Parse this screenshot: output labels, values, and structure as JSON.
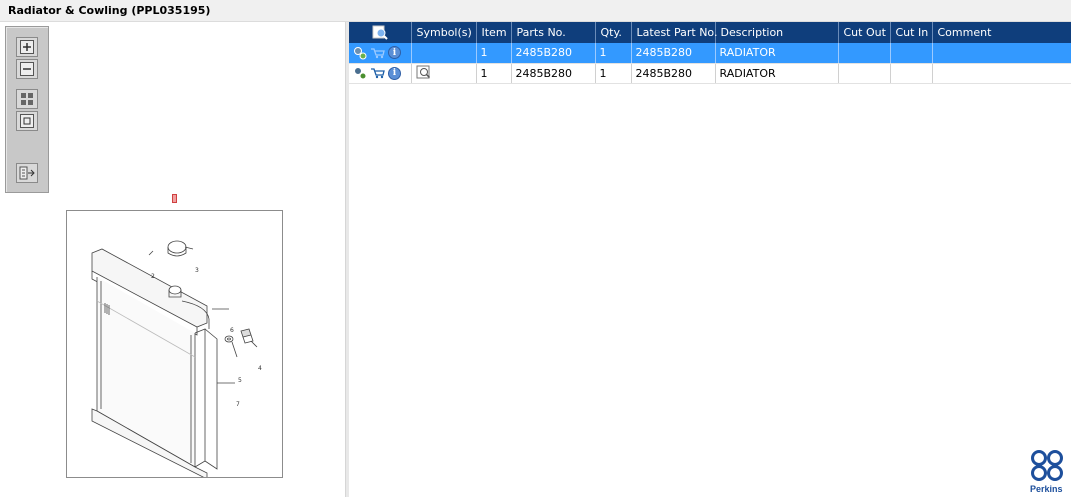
{
  "window": {
    "title": "Radiator & Cowling (PPL035195)"
  },
  "toolbar": {
    "tools": [
      {
        "name": "zoom-in-icon"
      },
      {
        "name": "zoom-out-icon"
      },
      {
        "name": "fit-all-icon"
      },
      {
        "name": "actual-size-icon"
      },
      {
        "name": "export-list-icon"
      }
    ]
  },
  "drawing": {
    "callouts": [
      "2",
      "3",
      "6",
      "4",
      "5",
      "7"
    ]
  },
  "table": {
    "columns": [
      "Symbol(s)",
      "Item",
      "Parts No.",
      "Qty.",
      "Latest Part No.",
      "Description",
      "Cut Out",
      "Cut In",
      "Comment"
    ],
    "rows": [
      {
        "item": "1",
        "parts_no": "2485B280",
        "qty": "1",
        "latest_part_no": "2485B280",
        "description": "RADIATOR",
        "cut_out": "",
        "cut_in": "",
        "comment": "",
        "selected": true
      },
      {
        "item": "1",
        "parts_no": "2485B280",
        "qty": "1",
        "latest_part_no": "2485B280",
        "description": "RADIATOR",
        "cut_out": "",
        "cut_in": "",
        "comment": "",
        "selected": false
      }
    ]
  },
  "logo": {
    "text": "Perkins"
  },
  "colors": {
    "header": "#0f3e7c",
    "selected_row": "#3399ff",
    "brand": "#1d4f9c"
  }
}
